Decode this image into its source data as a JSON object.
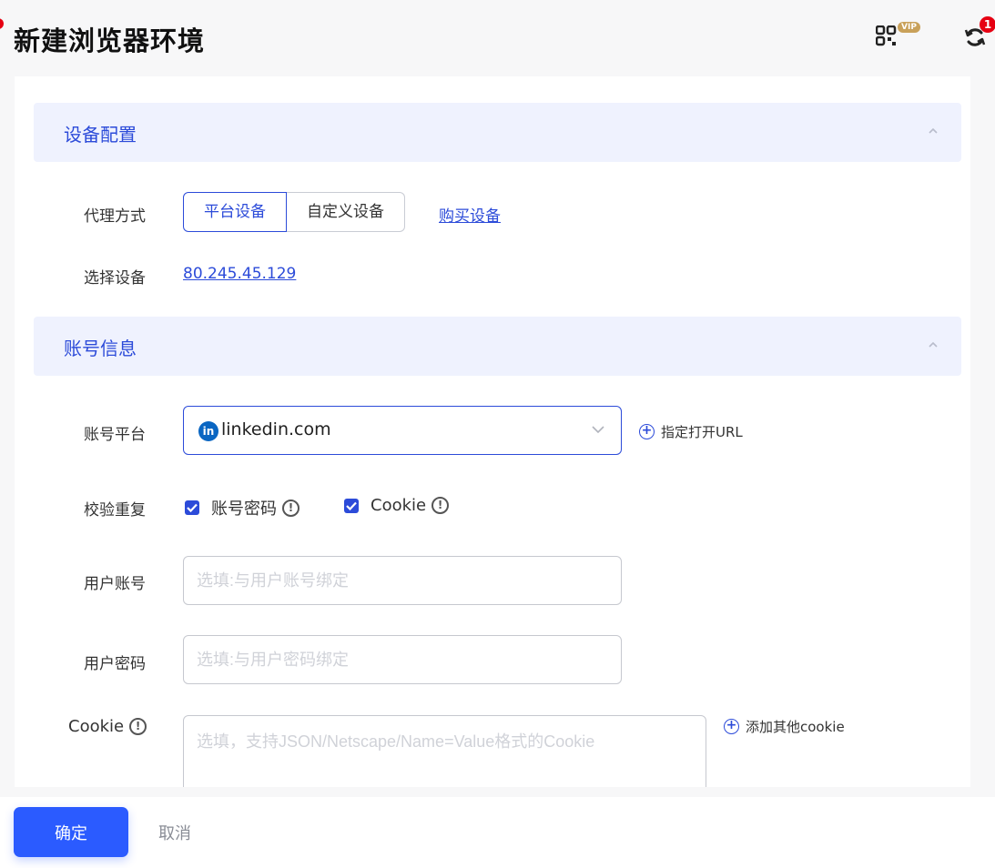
{
  "header": {
    "title": "新建浏览器环境",
    "vip_label": "VIP",
    "sync_badge": "1"
  },
  "device_section": {
    "title": "设备配置",
    "proxy_label": "代理方式",
    "proxy_options": [
      "平台设备",
      "自定义设备"
    ],
    "proxy_selected": "平台设备",
    "buy_link": "购买设备",
    "select_device_label": "选择设备",
    "device_ip": "80.245.45.129"
  },
  "account_section": {
    "title": "账号信息",
    "platform_label": "账号平台",
    "platform_value": "linkedin.com",
    "platform_icon": "in",
    "url_link": "指定打开URL",
    "verify_label": "校验重复",
    "check_password": "账号密码",
    "check_cookie": "Cookie",
    "username_label": "用户账号",
    "username_placeholder": "选填:与用户账号绑定",
    "password_label": "用户密码",
    "password_placeholder": "选填:与用户密码绑定",
    "cookie_label": "Cookie",
    "cookie_placeholder": "选填，支持JSON/Netscape/Name=Value格式的Cookie",
    "add_cookie_link": "添加其他cookie"
  },
  "footer": {
    "confirm": "确定",
    "cancel": "取消"
  },
  "colors": {
    "accent": "#2c4bd9",
    "primary_button": "#2b5bff",
    "section_bg": "#eff2fe",
    "badge_red": "#e60012",
    "linkedin": "#0a66c2"
  }
}
